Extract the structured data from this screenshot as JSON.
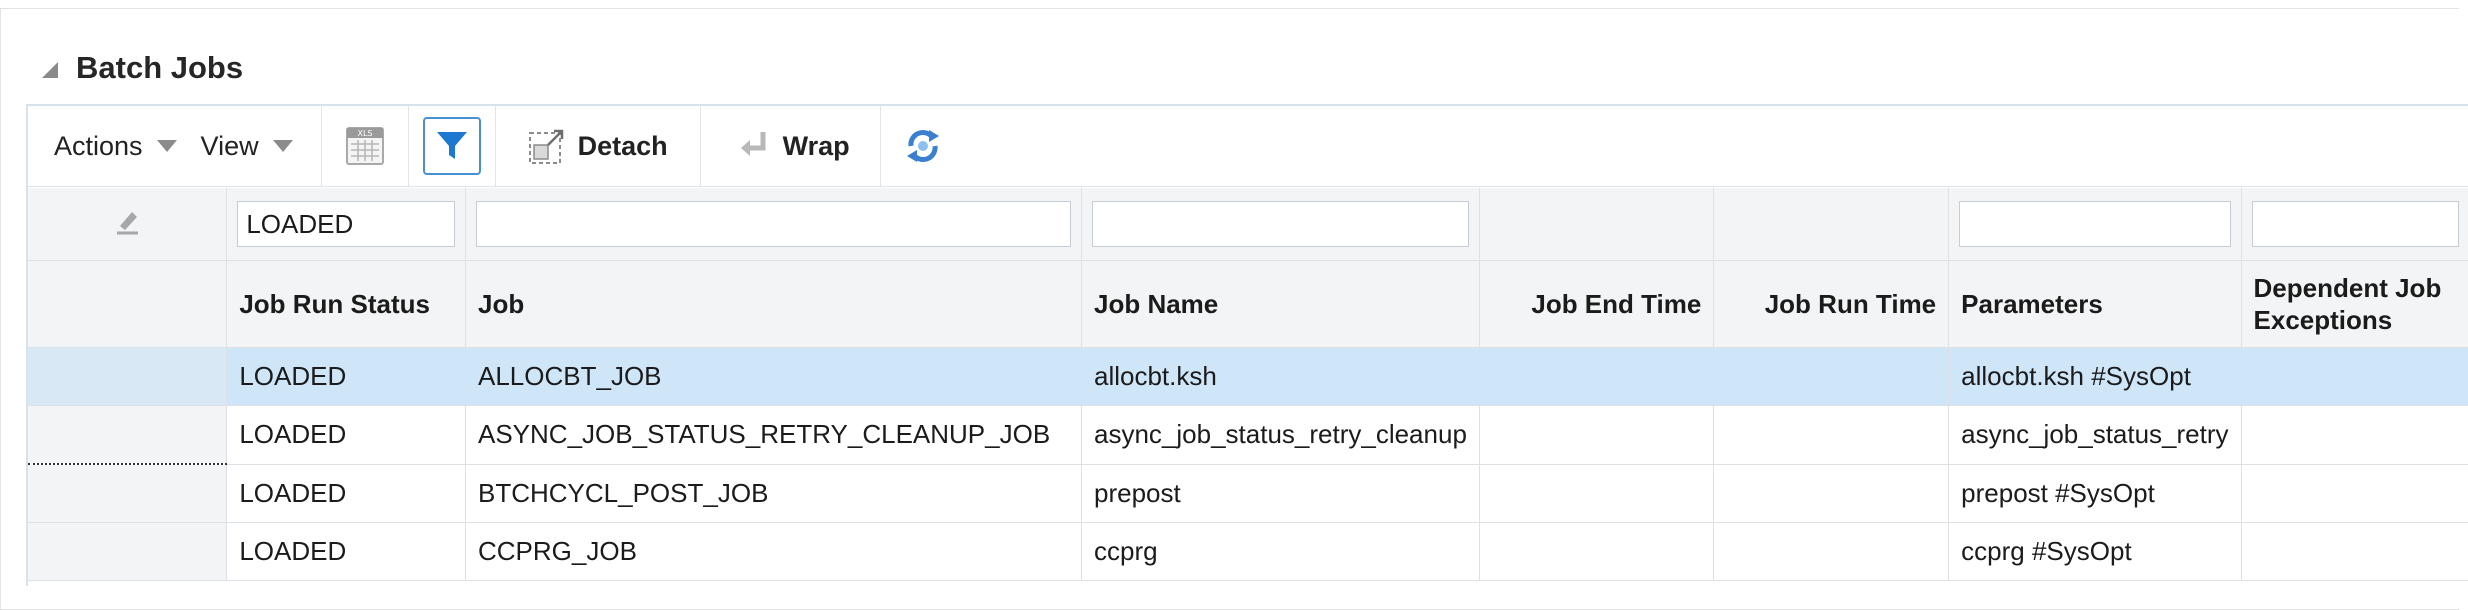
{
  "section": {
    "title": "Batch Jobs"
  },
  "toolbar": {
    "actions_label": "Actions",
    "view_label": "View",
    "detach_label": "Detach",
    "wrap_label": "Wrap",
    "export_icon": "xls-export-icon",
    "filter_icon": "filter-icon",
    "refresh_icon": "refresh-icon"
  },
  "filters": {
    "job_run_status": "LOADED",
    "job": "",
    "job_name": "",
    "parameters": "",
    "dependent_job_exceptions": ""
  },
  "columns": {
    "job_run_status": "Job Run Status",
    "job": "Job",
    "job_name": "Job Name",
    "job_end_time": "Job End Time",
    "job_run_time": "Job Run Time",
    "parameters": "Parameters",
    "dependent_job_exceptions": "Dependent Job Exceptions"
  },
  "rows": [
    {
      "status": "LOADED",
      "job": "ALLOCBT_JOB",
      "job_name": "allocbt.ksh",
      "end_time": "",
      "run_time": "",
      "parameters": "allocbt.ksh #SysOpt",
      "dependent": ""
    },
    {
      "status": "LOADED",
      "job": "ASYNC_JOB_STATUS_RETRY_CLEANUP_JOB",
      "job_name": "async_job_status_retry_cleanup",
      "end_time": "",
      "run_time": "",
      "parameters": "async_job_status_retry",
      "dependent": ""
    },
    {
      "status": "LOADED",
      "job": "BTCHCYCL_POST_JOB",
      "job_name": "prepost",
      "end_time": "",
      "run_time": "",
      "parameters": "prepost #SysOpt",
      "dependent": ""
    },
    {
      "status": "LOADED",
      "job": "CCPRG_JOB",
      "job_name": "ccprg",
      "end_time": "",
      "run_time": "",
      "parameters": "ccprg #SysOpt",
      "dependent": ""
    }
  ],
  "colors": {
    "selected_row": "#cfe6f9",
    "header_bg": "#f2f4f6",
    "accent": "#4a8fd4"
  }
}
